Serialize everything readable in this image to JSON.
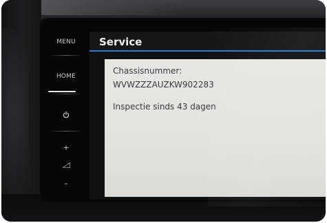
{
  "side_menu": {
    "menu_label": "MENU",
    "home_label": "HOME",
    "power_icon": "power-icon",
    "volume_up": "+",
    "volume_icon": "volume-icon",
    "volume_down": "–"
  },
  "screen": {
    "title": "Service",
    "accent_color": "#2f7ad1",
    "chassis_label": "Chassisnummer:",
    "chassis_value": "WVWZZZAUZKW902283",
    "inspection_text": "Inspectie sinds 43 dagen"
  }
}
